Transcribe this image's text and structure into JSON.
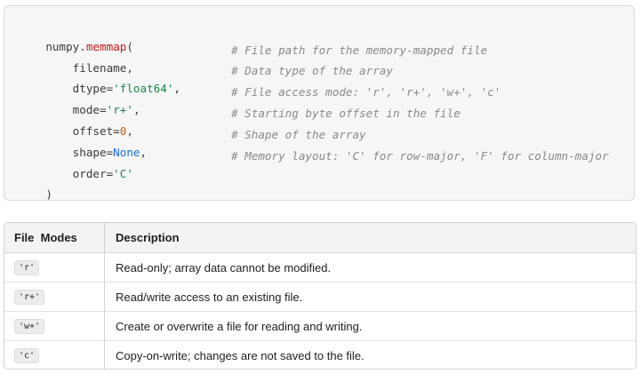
{
  "code": {
    "lines": [
      {
        "parts": [
          {
            "text": "numpy.",
            "cls": "tok-name"
          },
          {
            "text": "memmap",
            "cls": "tok-func"
          },
          {
            "text": "(",
            "cls": "tok-name"
          }
        ],
        "comment": ""
      },
      {
        "parts": [
          {
            "text": "    filename,",
            "cls": "tok-name"
          }
        ],
        "comment": "# File path for the memory-mapped file"
      },
      {
        "parts": [
          {
            "text": "    dtype=",
            "cls": "tok-name"
          },
          {
            "text": "'float64'",
            "cls": "tok-str"
          },
          {
            "text": ",",
            "cls": "tok-name"
          }
        ],
        "comment": "# Data type of the array"
      },
      {
        "parts": [
          {
            "text": "    mode=",
            "cls": "tok-name"
          },
          {
            "text": "'r+'",
            "cls": "tok-str"
          },
          {
            "text": ",",
            "cls": "tok-name"
          }
        ],
        "comment": "# File access mode: 'r', 'r+', 'w+', 'c'"
      },
      {
        "parts": [
          {
            "text": "    offset=",
            "cls": "tok-name"
          },
          {
            "text": "0",
            "cls": "tok-num"
          },
          {
            "text": ",",
            "cls": "tok-name"
          }
        ],
        "comment": "# Starting byte offset in the file"
      },
      {
        "parts": [
          {
            "text": "    shape=",
            "cls": "tok-name"
          },
          {
            "text": "None",
            "cls": "tok-kw"
          },
          {
            "text": ",",
            "cls": "tok-name"
          }
        ],
        "comment": "# Shape of the array"
      },
      {
        "parts": [
          {
            "text": "    order=",
            "cls": "tok-name"
          },
          {
            "text": "'C'",
            "cls": "tok-str"
          }
        ],
        "comment": "# Memory layout: 'C' for row-major, 'F' for column-major"
      },
      {
        "parts": [
          {
            "text": ")",
            "cls": "tok-name"
          }
        ],
        "comment": ""
      }
    ]
  },
  "table": {
    "headers": [
      "File  Modes",
      "Description"
    ],
    "rows": [
      {
        "mode": "'r'",
        "description": "Read-only; array data cannot be modified."
      },
      {
        "mode": "'r+'",
        "description": "Read/write access to an existing file."
      },
      {
        "mode": "'w+'",
        "description": "Create or overwrite a file for reading and writing."
      },
      {
        "mode": "'c'",
        "description": "Copy-on-write; changes are not saved to the file."
      }
    ]
  }
}
